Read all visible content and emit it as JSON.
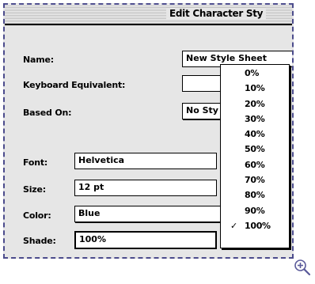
{
  "window": {
    "title": "Edit Character Sty"
  },
  "form": {
    "name_label": "Name:",
    "name_value": "New Style Sheet",
    "keyboard_label": "Keyboard Equivalent:",
    "keyboard_value": "",
    "based_on_label": "Based On:",
    "based_on_value": "No Sty",
    "font_label": "Font:",
    "font_value": "Helvetica",
    "size_label": "Size:",
    "size_value": "12  pt",
    "color_label": "Color:",
    "color_value": "Blue",
    "shade_label": "Shade:",
    "shade_value": "100%"
  },
  "shade_menu": {
    "items": [
      "0%",
      "10%",
      "20%",
      "30%",
      "40%",
      "50%",
      "60%",
      "70%",
      "80%",
      "90%",
      "100%"
    ],
    "selected": "100%",
    "check_mark": "✓"
  },
  "icons": {
    "zoom": "zoom-in-icon"
  }
}
